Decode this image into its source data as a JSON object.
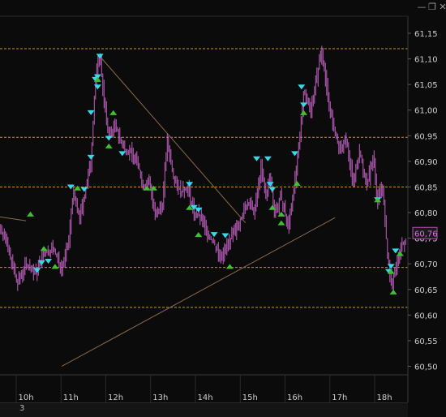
{
  "window": {
    "minimize_glyph": "—",
    "restore_glyph": "❐",
    "close_glyph": "✕"
  },
  "bottom_bar": {
    "text": "3"
  },
  "chart_data": {
    "type": "candlestick",
    "title": "",
    "xlabel": "",
    "ylabel": "",
    "ylim": [
      60.5,
      61.15
    ],
    "y_ticks": [
      "61,15",
      "61,10",
      "61,05",
      "61,00",
      "60,95",
      "60,90",
      "60,85",
      "60,80",
      "60,75",
      "60,70",
      "60,65",
      "60,60",
      "60,55",
      "60,50"
    ],
    "x_ticks": [
      "10h",
      "11h",
      "12h",
      "13h",
      "14h",
      "15h",
      "16h",
      "17h",
      "18h"
    ],
    "last_price_label": "60,76",
    "last_price": 60.76,
    "horizontal_levels": [
      61.12,
      60.947,
      60.85,
      60.693,
      60.615
    ],
    "trendlines": [
      {
        "from": [
          8.4,
          60.805
        ],
        "to": [
          10.0,
          60.784
        ]
      },
      {
        "from": [
          11.6,
          61.11
        ],
        "to": [
          14.9,
          60.78
        ]
      },
      {
        "from": [
          10.8,
          60.5
        ],
        "to": [
          16.9,
          60.79
        ]
      }
    ],
    "price_path": [
      [
        9.3,
        60.79
      ],
      [
        9.5,
        60.76
      ],
      [
        9.7,
        60.7
      ],
      [
        9.8,
        60.66
      ],
      [
        10.0,
        60.7
      ],
      [
        10.2,
        60.68
      ],
      [
        10.4,
        60.72
      ],
      [
        10.6,
        60.73
      ],
      [
        10.8,
        60.69
      ],
      [
        10.95,
        60.74
      ],
      [
        11.05,
        60.84
      ],
      [
        11.2,
        60.79
      ],
      [
        11.3,
        60.83
      ],
      [
        11.45,
        60.9
      ],
      [
        11.55,
        61.06
      ],
      [
        11.65,
        61.11
      ],
      [
        11.75,
        61.01
      ],
      [
        11.85,
        60.95
      ],
      [
        12.0,
        60.97
      ],
      [
        12.15,
        60.93
      ],
      [
        12.3,
        60.92
      ],
      [
        12.5,
        60.9
      ],
      [
        12.6,
        60.85
      ],
      [
        12.75,
        60.86
      ],
      [
        12.9,
        60.79
      ],
      [
        13.05,
        60.82
      ],
      [
        13.15,
        60.94
      ],
      [
        13.3,
        60.87
      ],
      [
        13.45,
        60.84
      ],
      [
        13.6,
        60.85
      ],
      [
        13.75,
        60.8
      ],
      [
        13.9,
        60.79
      ],
      [
        14.05,
        60.76
      ],
      [
        14.2,
        60.74
      ],
      [
        14.35,
        60.71
      ],
      [
        14.5,
        60.74
      ],
      [
        14.65,
        60.76
      ],
      [
        14.8,
        60.79
      ],
      [
        14.95,
        60.82
      ],
      [
        15.1,
        60.8
      ],
      [
        15.25,
        60.89
      ],
      [
        15.35,
        60.83
      ],
      [
        15.45,
        60.87
      ],
      [
        15.55,
        60.8
      ],
      [
        15.7,
        60.83
      ],
      [
        15.85,
        60.77
      ],
      [
        16.0,
        60.86
      ],
      [
        16.1,
        60.93
      ],
      [
        16.2,
        61.04
      ],
      [
        16.35,
        61.0
      ],
      [
        16.5,
        61.07
      ],
      [
        16.6,
        61.12
      ],
      [
        16.7,
        61.05
      ],
      [
        16.85,
        60.97
      ],
      [
        17.0,
        60.92
      ],
      [
        17.15,
        60.94
      ],
      [
        17.3,
        60.86
      ],
      [
        17.45,
        60.92
      ],
      [
        17.6,
        60.85
      ],
      [
        17.75,
        60.91
      ],
      [
        17.85,
        60.82
      ],
      [
        17.95,
        60.86
      ],
      [
        18.05,
        60.74
      ],
      [
        18.15,
        60.66
      ],
      [
        18.25,
        60.69
      ],
      [
        18.4,
        60.74
      ],
      [
        18.5,
        60.75
      ]
    ],
    "signals_down": [
      [
        11.0,
        60.85
      ],
      [
        11.55,
        61.06
      ],
      [
        11.65,
        61.105
      ],
      [
        11.6,
        61.065
      ],
      [
        11.6,
        61.045
      ],
      [
        11.45,
        60.995
      ],
      [
        11.45,
        60.908
      ],
      [
        11.3,
        60.845
      ],
      [
        11.85,
        60.945
      ],
      [
        12.15,
        60.915
      ],
      [
        13.65,
        60.855
      ],
      [
        13.75,
        60.81
      ],
      [
        13.85,
        60.805
      ],
      [
        14.2,
        60.757
      ],
      [
        14.45,
        60.755
      ],
      [
        15.15,
        60.905
      ],
      [
        15.4,
        60.905
      ],
      [
        15.45,
        60.855
      ],
      [
        15.5,
        60.845
      ],
      [
        16.0,
        60.915
      ],
      [
        16.15,
        61.045
      ],
      [
        16.2,
        61.01
      ],
      [
        17.85,
        60.825
      ],
      [
        18.1,
        60.685
      ],
      [
        18.15,
        60.695
      ],
      [
        18.25,
        60.725
      ],
      [
        10.25,
        60.687
      ],
      [
        10.35,
        60.702
      ],
      [
        10.5,
        60.705
      ]
    ],
    "signals_up": [
      [
        10.4,
        60.73
      ],
      [
        10.1,
        60.797
      ],
      [
        11.15,
        60.848
      ],
      [
        11.6,
        61.06
      ],
      [
        11.85,
        60.93
      ],
      [
        11.95,
        60.995
      ],
      [
        12.7,
        60.848
      ],
      [
        12.85,
        60.848
      ],
      [
        13.65,
        60.81
      ],
      [
        13.85,
        60.757
      ],
      [
        14.55,
        60.695
      ],
      [
        15.5,
        60.81
      ],
      [
        15.7,
        60.797
      ],
      [
        15.7,
        60.78
      ],
      [
        16.05,
        60.857
      ],
      [
        16.2,
        60.995
      ],
      [
        17.85,
        60.825
      ],
      [
        18.15,
        60.685
      ],
      [
        18.2,
        60.645
      ],
      [
        18.35,
        60.72
      ],
      [
        10.65,
        60.695
      ]
    ],
    "colors": {
      "background": "#0b0b0b",
      "price": "#c060c0",
      "level_line": "#c8962a",
      "trendline": "#8a6a4a",
      "signal_down": "#38d8e8",
      "signal_up": "#40c030",
      "axis_text": "#cfcfcf",
      "last_price_box": "#b050b0"
    }
  }
}
